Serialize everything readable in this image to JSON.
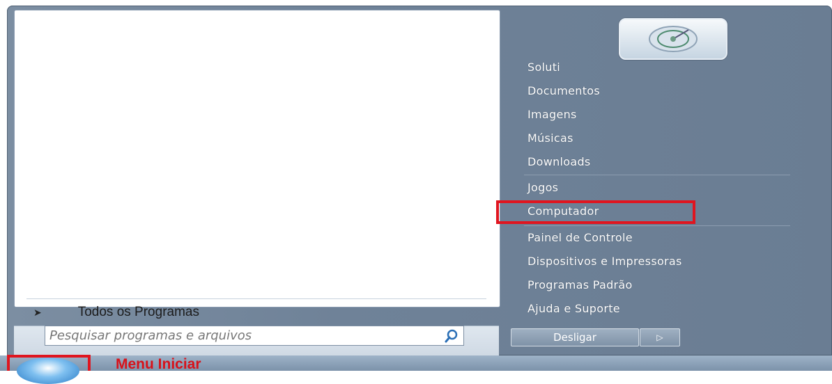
{
  "left_pane": {
    "all_programs_label": "Todos os Programas",
    "search_placeholder": "Pesquisar programas e arquivos"
  },
  "right_pane": {
    "items": [
      "Soluti",
      "Documentos",
      "Imagens",
      "Músicas",
      "Downloads",
      "Jogos",
      "Computador",
      "Painel de Controle",
      "Dispositivos e Impressoras",
      "Programas Padrão",
      "Ajuda e Suporte"
    ],
    "highlighted_item": "Computador"
  },
  "shutdown": {
    "label": "Desligar",
    "arrow_glyph": "▷"
  },
  "taskbar": {
    "start_label": "Menu Iniciar"
  },
  "colors": {
    "highlight": "#e0151f",
    "right_pane_bg": "#6f8298",
    "label_red": "#d8121a"
  },
  "icons": {
    "search": "search-icon",
    "user_picture": "user-picture-icon",
    "start_orb": "windows-start-icon",
    "expand_arrow": "triangle-right-icon"
  }
}
